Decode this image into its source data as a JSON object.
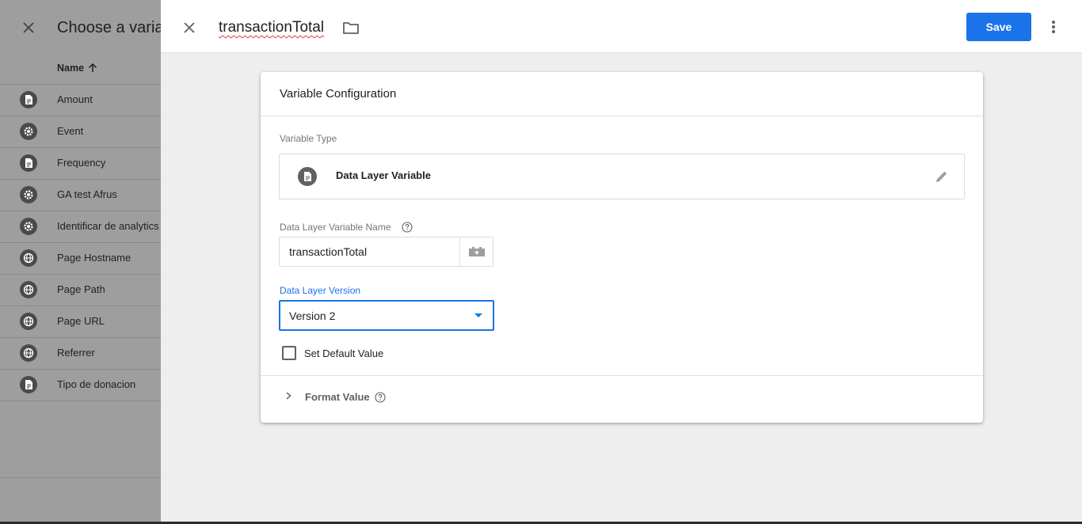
{
  "background_panel": {
    "title": "Choose a varia",
    "column_header": "Name",
    "rows": [
      {
        "label": "Amount",
        "icon": "document-icon"
      },
      {
        "label": "Event",
        "icon": "gear-icon"
      },
      {
        "label": "Frequency",
        "icon": "document-icon"
      },
      {
        "label": "GA test Afrus",
        "icon": "gear-icon"
      },
      {
        "label": "Identificar de analytics",
        "icon": "gear-icon"
      },
      {
        "label": "Page Hostname",
        "icon": "globe-icon"
      },
      {
        "label": "Page Path",
        "icon": "globe-icon"
      },
      {
        "label": "Page URL",
        "icon": "globe-icon"
      },
      {
        "label": "Referrer",
        "icon": "globe-icon"
      },
      {
        "label": "Tipo de donacion",
        "icon": "document-icon"
      }
    ]
  },
  "editor": {
    "variable_name": "transactionTotal",
    "save_label": "Save",
    "card": {
      "title": "Variable Configuration",
      "variable_type_label": "Variable Type",
      "variable_type_value": "Data Layer Variable",
      "dlv_name_label": "Data Layer Variable Name",
      "dlv_name_value": "transactionTotal",
      "dlv_version_label": "Data Layer Version",
      "dlv_version_value": "Version 2",
      "default_value_label": "Set Default Value",
      "default_value_checked": false,
      "format_value_label": "Format Value"
    }
  },
  "colors": {
    "accent": "#1a73e8",
    "overlay": "#9e9e9e",
    "sheet_bg": "#eeeeee"
  }
}
